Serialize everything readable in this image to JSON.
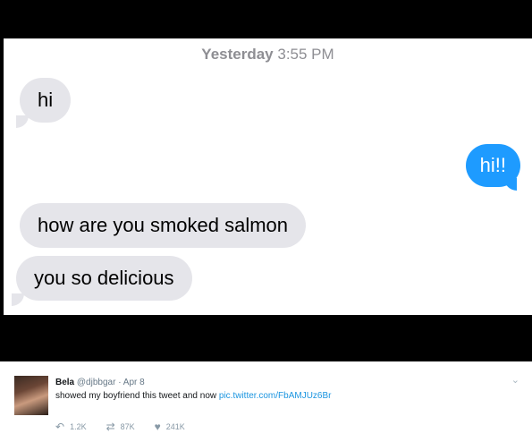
{
  "conversation": {
    "timestamp_day": "Yesterday",
    "timestamp_time": "3:55 PM",
    "messages": [
      {
        "text": "hi",
        "side": "incoming"
      },
      {
        "text": "hi!!",
        "side": "outgoing"
      },
      {
        "text": "how are you smoked salmon",
        "side": "incoming"
      },
      {
        "text": "you so delicious",
        "side": "incoming"
      }
    ]
  },
  "tweet": {
    "name": "Bela",
    "handle": "@djbbgar",
    "separator": "·",
    "date": "Apr 8",
    "text": "showed my boyfriend this tweet and now ",
    "link": "pic.twitter.com/FbAMJUz6Br",
    "replies": "1.2K",
    "retweets": "87K",
    "likes": "241K"
  },
  "colors": {
    "outgoing_bubble": "#1e9bff",
    "incoming_bubble": "#e5e5ea",
    "link": "#1b95e0"
  },
  "icons": {
    "reply": "reply-icon",
    "retweet": "retweet-icon",
    "like": "heart-icon",
    "menu": "chevron-down-icon"
  }
}
